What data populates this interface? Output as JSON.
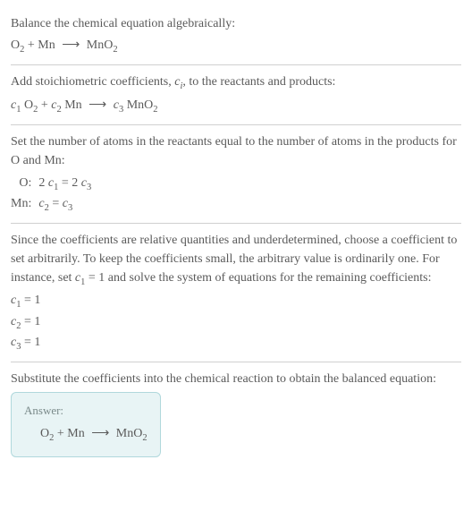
{
  "section1": {
    "text": "Balance the chemical equation algebraically:",
    "equation_html": "O<sub>2</sub> + Mn <span class='arrow'>⟶</span> MnO<sub>2</sub>"
  },
  "section2": {
    "text_html": "Add stoichiometric coefficients, <span class='italic'>c<sub>i</sub></span>, to the reactants and products:",
    "equation_html": "<span class='italic'>c</span><sub>1</sub> O<sub>2</sub> + <span class='italic'>c</span><sub>2</sub> Mn <span class='arrow'>⟶</span> <span class='italic'>c</span><sub>3</sub> MnO<sub>2</sub>"
  },
  "section3": {
    "text": "Set the number of atoms in the reactants equal to the number of atoms in the products for O and Mn:",
    "rows": [
      {
        "label": "O:",
        "eq_html": "2 <span class='italic'>c</span><sub>1</sub> = 2 <span class='italic'>c</span><sub>3</sub>"
      },
      {
        "label": "Mn:",
        "eq_html": "<span class='italic'>c</span><sub>2</sub> = <span class='italic'>c</span><sub>3</sub>"
      }
    ]
  },
  "section4": {
    "text_html": "Since the coefficients are relative quantities and underdetermined, choose a coefficient to set arbitrarily. To keep the coefficients small, the arbitrary value is ordinarily one. For instance, set <span class='italic'>c</span><sub>1</sub> = 1 and solve the system of equations for the remaining coefficients:",
    "coeffs": [
      "<span class='italic'>c</span><sub>1</sub> = 1",
      "<span class='italic'>c</span><sub>2</sub> = 1",
      "<span class='italic'>c</span><sub>3</sub> = 1"
    ]
  },
  "section5": {
    "text": "Substitute the coefficients into the chemical reaction to obtain the balanced equation:",
    "answer_label": "Answer:",
    "answer_html": "O<sub>2</sub> + Mn <span class='arrow'>⟶</span> MnO<sub>2</sub>"
  },
  "chart_data": {
    "type": "table",
    "title": "Balancing O2 + Mn -> MnO2",
    "reactants": [
      "O2",
      "Mn"
    ],
    "products": [
      "MnO2"
    ],
    "atom_balance": [
      {
        "element": "O",
        "lhs": "2 c1",
        "rhs": "2 c3"
      },
      {
        "element": "Mn",
        "lhs": "c2",
        "rhs": "c3"
      }
    ],
    "solution": {
      "c1": 1,
      "c2": 1,
      "c3": 1
    },
    "balanced": "O2 + Mn -> MnO2"
  }
}
